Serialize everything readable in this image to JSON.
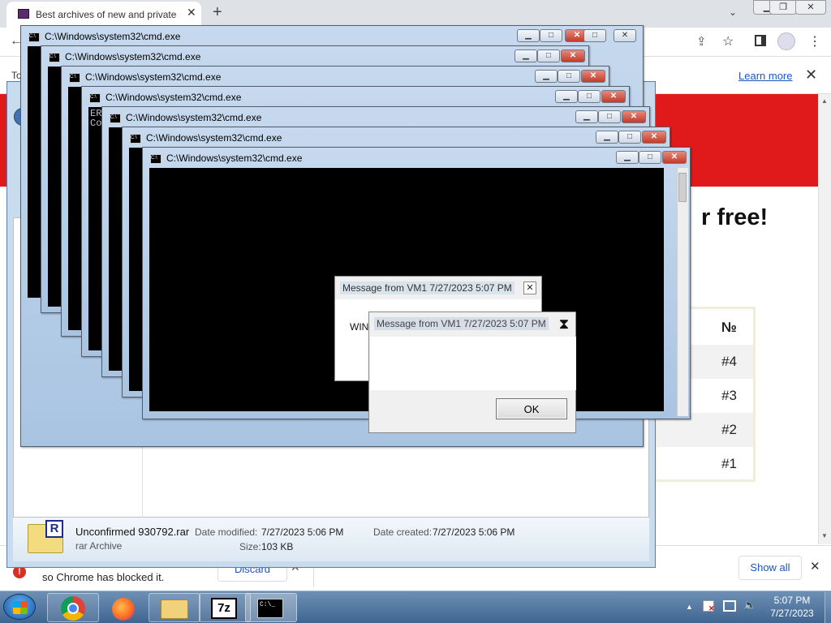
{
  "browser": {
    "tab_title": "Best archives of new and private",
    "learn_more": "Learn more",
    "to_fragment": "To",
    "blocked_text": "so Chrome has blocked it.",
    "discard_label": "Discard",
    "show_all": "Show all",
    "page": {
      "headline_fragment": "r free!",
      "rank_header": "№",
      "ranks": [
        "#4",
        "#3",
        "#2",
        "#1"
      ]
    }
  },
  "explorer": {
    "file_name": "Unconfirmed 930792.rar",
    "file_type": "rar Archive",
    "date_modified_label": "Date modified:",
    "date_modified": "7/27/2023 5:06 PM",
    "size_label": "Size:",
    "size": "103 KB",
    "date_created_label": "Date created:",
    "date_created": "7/27/2023 5:06 PM"
  },
  "cmd": {
    "title": "C:\\Windows\\system32\\cmd.exe",
    "text_er": "ER",
    "text_co": "Co"
  },
  "dialogs": {
    "msg1_title": "Message from VM1 7/27/2023 5:07 PM",
    "msg1_body": "WIN",
    "msg2_title": "Message from VM1 7/27/2023 5:07 PM",
    "ok_label": "OK"
  },
  "taskbar": {
    "time": "5:07 PM",
    "date": "7/27/2023",
    "sevenzip_label": "7z",
    "cmd_label": "C:\\_"
  },
  "icons": [
    "chrome-icon",
    "firefox-icon",
    "file-explorer-icon",
    "7zip-icon",
    "cmd-icon"
  ]
}
